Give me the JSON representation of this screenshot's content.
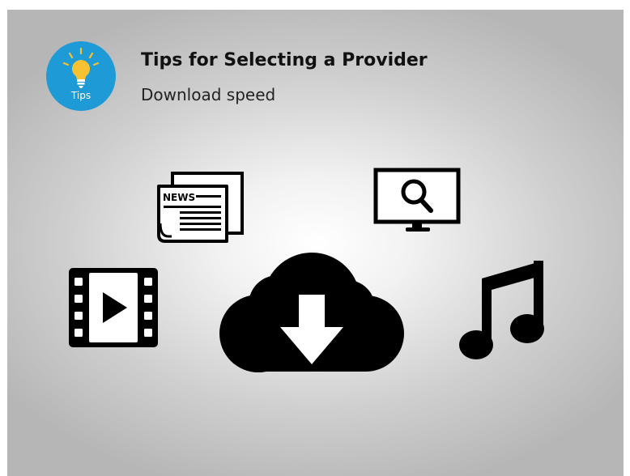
{
  "header": {
    "badge_label": "Tips",
    "title": "Tips for Selecting a Provider",
    "subtitle": "Download speed"
  },
  "newspaper": {
    "label": "NEWS"
  },
  "icons": {
    "badge": "lightbulb-icon",
    "news": "newspaper-icon",
    "monitor": "monitor-search-icon",
    "video": "video-film-icon",
    "download": "cloud-download-icon",
    "music": "music-note-icon"
  },
  "colors": {
    "badge_blue": "#1e9ad6",
    "bulb_yellow": "#f7c232",
    "icon_black": "#000000"
  }
}
